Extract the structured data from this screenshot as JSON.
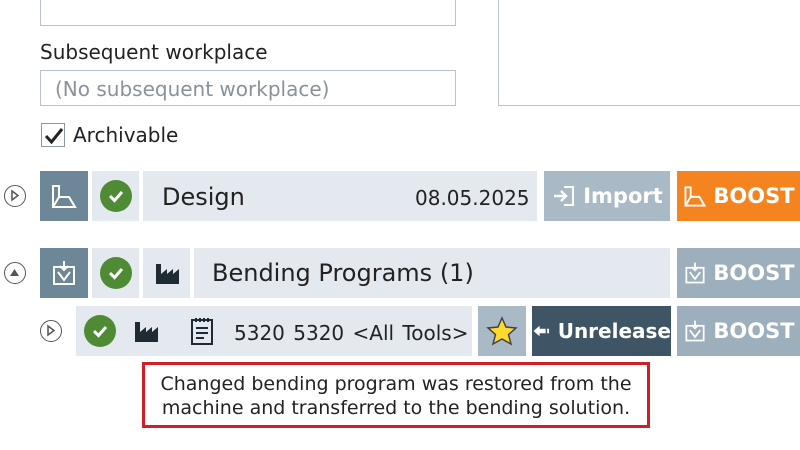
{
  "form": {
    "subsequent_workplace_label": "Subsequent workplace",
    "subsequent_workplace_placeholder": "(No subsequent workplace)",
    "archivable_label": "Archivable",
    "archivable_checked": true
  },
  "design": {
    "title": "Design",
    "date": "08.05.2025",
    "import_label": "Import",
    "boost_label": "BOOST",
    "status": "ok"
  },
  "bending": {
    "title": "Bending Programs (1)",
    "boost_label": "BOOST",
    "status": "ok",
    "program": {
      "text": "5320  5320  <All Tools>",
      "unrelease_label": "Unrelease",
      "boost_label": "BOOST",
      "status": "ok",
      "favorite": true
    }
  },
  "message": {
    "line1": "Changed bending program was restored from the",
    "line2": "machine and transferred to the bending solution."
  },
  "colors": {
    "boost_orange": "#f5831f",
    "ok_green": "#4f8a35",
    "unrelease_dark": "#3f5566",
    "highlight_red": "#d11f2a"
  }
}
